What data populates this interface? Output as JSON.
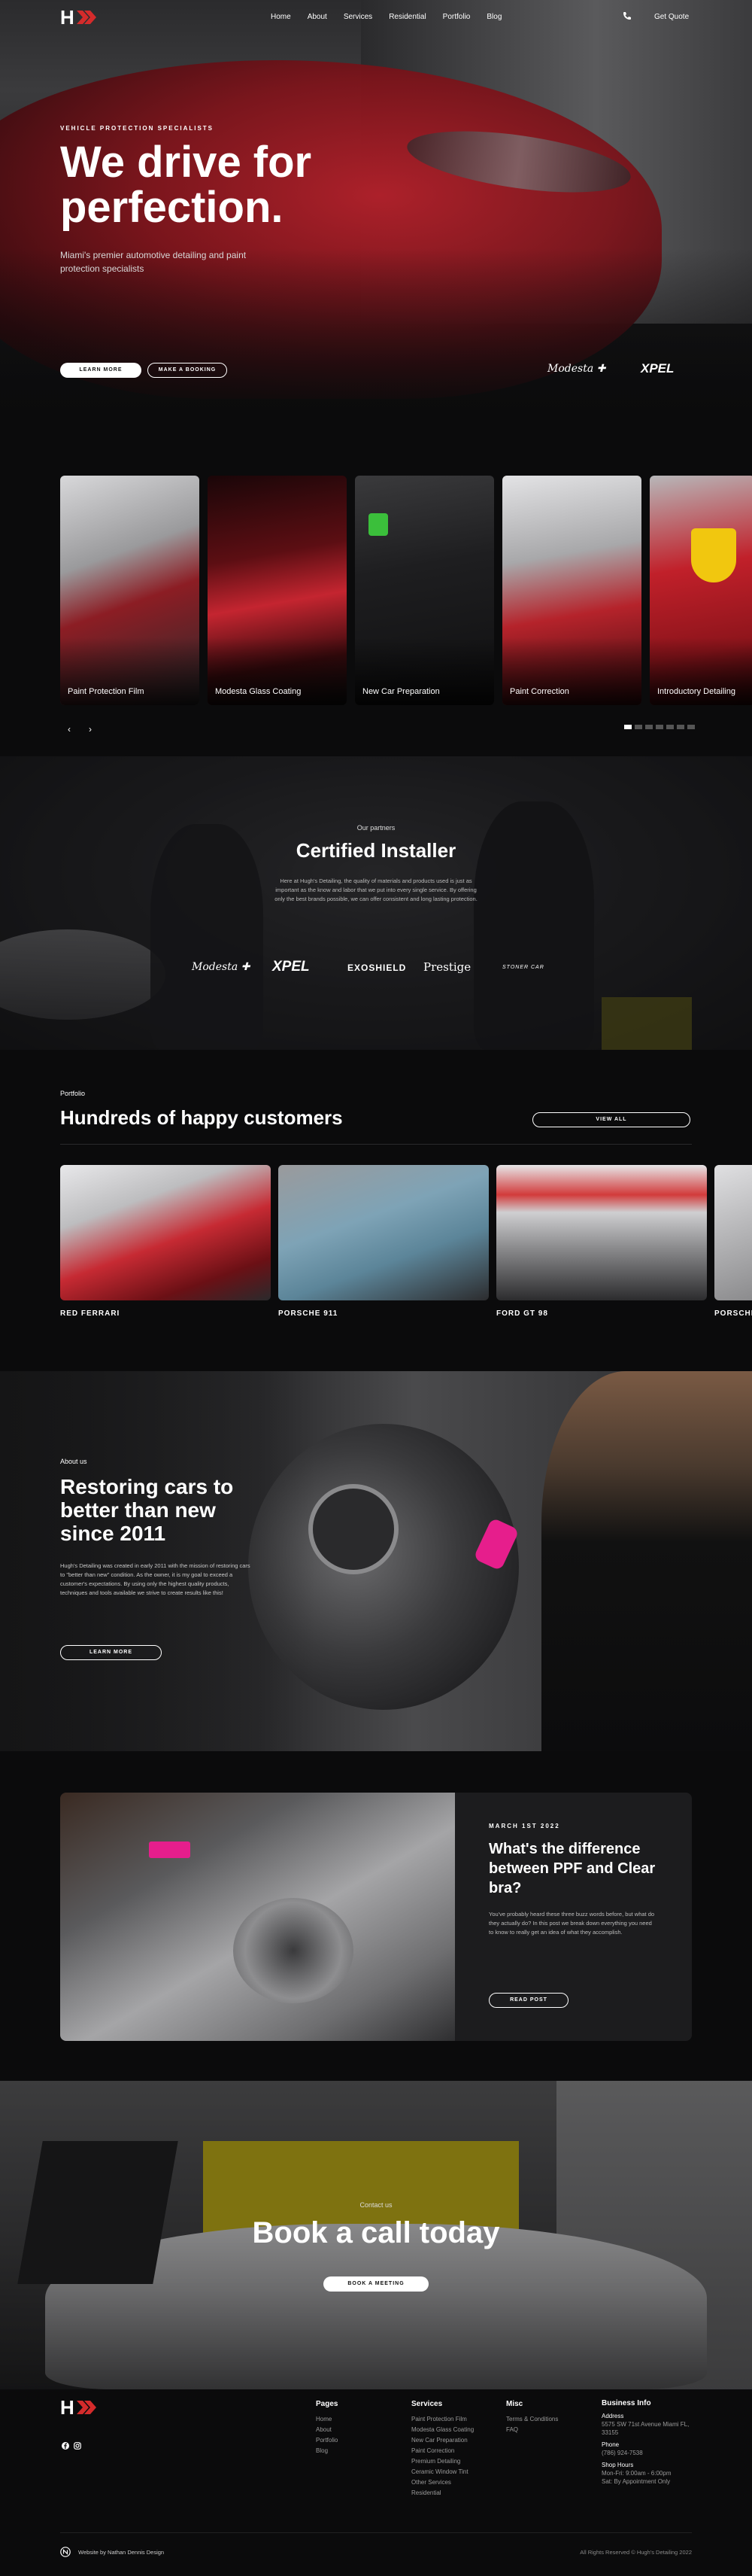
{
  "nav": {
    "links": [
      "Home",
      "About",
      "Services",
      "Residential",
      "Portfolio",
      "Blog"
    ],
    "quote_label": "Get Quote",
    "logo_text": "H"
  },
  "hero": {
    "eyebrow": "VEHICLE PROTECTION SPECIALISTS",
    "title": "We drive for perfection.",
    "subtitle": "Miami's premier automotive detailing and paint protection specialists",
    "primary_button": "LEARN MORE",
    "secondary_button": "MAKE A BOOKING",
    "brand_logos": [
      "Modesta",
      "XPEL"
    ]
  },
  "services": {
    "cards": [
      {
        "label": "Paint Protection Film"
      },
      {
        "label": "Modesta Glass Coating"
      },
      {
        "label": "New Car Preparation"
      },
      {
        "label": "Paint Correction"
      },
      {
        "label": "Introductory Detailing"
      }
    ],
    "prev_arrow": "‹",
    "next_arrow": "›"
  },
  "partners": {
    "eyebrow": "Our partners",
    "title": "Certified Installer",
    "body": "Here at Hugh's Detailing, the quality of materials and products used is just as important as the know and labor that we put into every single service. By offering only the best brands possible, we can offer consistent and long lasting protection.",
    "logos": [
      "Modesta",
      "XPEL",
      "EXOSHIELD",
      "Prestige",
      "STONER CAR"
    ]
  },
  "portfolio": {
    "eyebrow": "Portfolio",
    "title": "Hundreds of happy customers",
    "view_all": "VIEW ALL",
    "items": [
      "RED FERRARI",
      "PORSCHE 911",
      "FORD GT 98",
      "PORSCHE"
    ]
  },
  "about": {
    "eyebrow": "About us",
    "title": "Restoring cars to better than new since 2011",
    "body": "Hugh's Detailing was created in early 2011 with the mission of restoring cars to \"better than new\" condition. As the owner, it is my goal to exceed a customer's expectations. By using only the highest quality products, techniques and tools available we strive to create results like this!",
    "button": "LEARN MORE"
  },
  "blog": {
    "date": "MARCH 1ST 2022",
    "title": "What's the difference between PPF and Clear bra?",
    "body": "You've probably heard these three buzz words before, but what do they actually do? In this post we break down everything you need to know to really get an idea of what they accomplish.",
    "button": "READ POST"
  },
  "book": {
    "eyebrow": "Contact us",
    "title": "Book a call today",
    "button": "BOOK A MEETING"
  },
  "footer": {
    "pages": {
      "title": "Pages",
      "items": [
        "Home",
        "About",
        "Portfolio",
        "Blog"
      ]
    },
    "services": {
      "title": "Services",
      "items": [
        "Paint Protection Film",
        "Modesta Glass Coating",
        "New Car Preparation",
        "Paint Correction",
        "Premium Detailing",
        "Ceramic Window Tint",
        "Other Services",
        "Residential"
      ]
    },
    "misc": {
      "title": "Misc",
      "items": [
        "Terms & Conditions",
        "FAQ"
      ]
    },
    "business": {
      "title": "Business Info",
      "address_label": "Address",
      "address": "5575 SW 71st Avenue Miami FL, 33155",
      "phone_label": "Phone",
      "phone": "(786) 924-7538",
      "hours_label": "Shop Hours",
      "hours_weekday": "Mon-Fri: 9:00am - 6:00pm",
      "hours_sat": "Sat: By Appointment Only"
    },
    "credit": "Website by Nathan Dennis Design",
    "copyright": "All Rights Reserved © Hugh's Detailing 2022"
  }
}
